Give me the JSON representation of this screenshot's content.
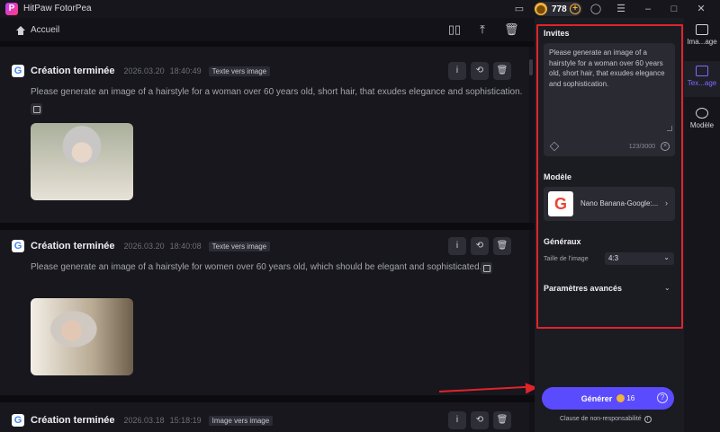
{
  "app": {
    "title": "HitPaw FotorPea",
    "logo": "P",
    "credits": "778"
  },
  "toolbar": {
    "home_label": "Accueil"
  },
  "cards": [
    {
      "title": "Création terminée",
      "date": "2026.03.20",
      "time": "18:40:49",
      "tag": "Texte vers image",
      "prompt": "Please generate an image of a hairstyle for a woman over 60 years old, short hair, that exudes elegance and sophistication."
    },
    {
      "title": "Création terminée",
      "date": "2026.03.20",
      "time": "18:40:08",
      "tag": "Texte vers image",
      "prompt": "Please generate an image of a hairstyle for women over 60 years old, which should be elegant and sophisticated."
    },
    {
      "title": "Création terminée",
      "date": "2026.03.18",
      "time": "15:18:19",
      "tag": "Image vers image"
    }
  ],
  "panel": {
    "prompts_title": "Invites",
    "prompt_text": "Please generate an image of a hairstyle for a woman over 60 years old, short hair, that exudes elegance and sophistication.",
    "counter": "123/3000",
    "model_title": "Modèle",
    "model_name": "Nano Banana-Google:...",
    "general_title": "Généraux",
    "size_label": "Taille de l'image",
    "size_value": "4:3",
    "advanced_title": "Paramètres avancés",
    "generate_label": "Générer",
    "generate_cost": "16",
    "disclaimer": "Clause de non-responsabilité"
  },
  "nav": [
    {
      "label": "Ima...age",
      "icon": "image-icon"
    },
    {
      "label": "Tex...age",
      "icon": "text-to-image-icon"
    },
    {
      "label": "Modèle",
      "icon": "model-icon"
    }
  ],
  "colors": {
    "accent": "#5b4bff",
    "highlight": "#e0242a",
    "coin": "#f2b33a"
  }
}
